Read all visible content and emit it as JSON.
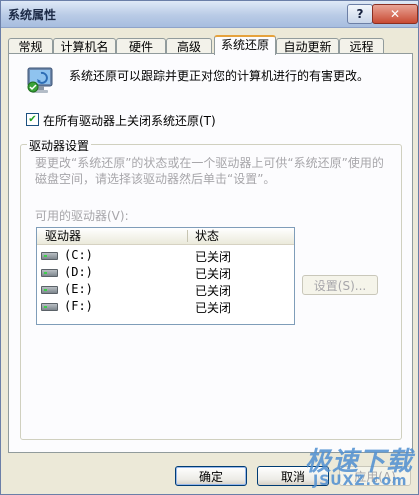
{
  "window": {
    "title": "系统属性",
    "help_label": "?",
    "close_label": "✕"
  },
  "tabs": [
    {
      "label": "常规",
      "active": false
    },
    {
      "label": "计算机名",
      "active": false
    },
    {
      "label": "硬件",
      "active": false
    },
    {
      "label": "高级",
      "active": false
    },
    {
      "label": "系统还原",
      "active": true
    },
    {
      "label": "自动更新",
      "active": false
    },
    {
      "label": "远程",
      "active": false
    }
  ],
  "system_restore": {
    "intro_text": "系统还原可以跟踪并更正对您的计算机进行的有害更改。",
    "disable_checkbox": {
      "label": "在所有驱动器上关闭系统还原(T)",
      "checked": true
    },
    "drive_settings": {
      "group_title": "驱动器设置",
      "description": "要更改“系统还原”的状态或在一个驱动器上可供“系统还原”使用的磁盘空间，请选择该驱动器然后单击“设置”。",
      "available_label": "可用的驱动器(V):",
      "columns": [
        "驱动器",
        "状态"
      ],
      "drives": [
        {
          "name": "(C:)",
          "status": "已关闭"
        },
        {
          "name": "(D:)",
          "status": "已关闭"
        },
        {
          "name": "(E:)",
          "status": "已关闭"
        },
        {
          "name": "(F:)",
          "status": "已关闭"
        }
      ],
      "settings_button": "设置(S)..."
    }
  },
  "footer": {
    "ok": "确定",
    "cancel": "取消",
    "apply": "应用(A)"
  },
  "watermark": {
    "main": "极速下载",
    "sub": "JSUXZ.com"
  },
  "colors": {
    "accent_tab_border": "#e6a23c",
    "window_bg": "#ece9d8",
    "disabled_text": "#a7a6aa"
  }
}
